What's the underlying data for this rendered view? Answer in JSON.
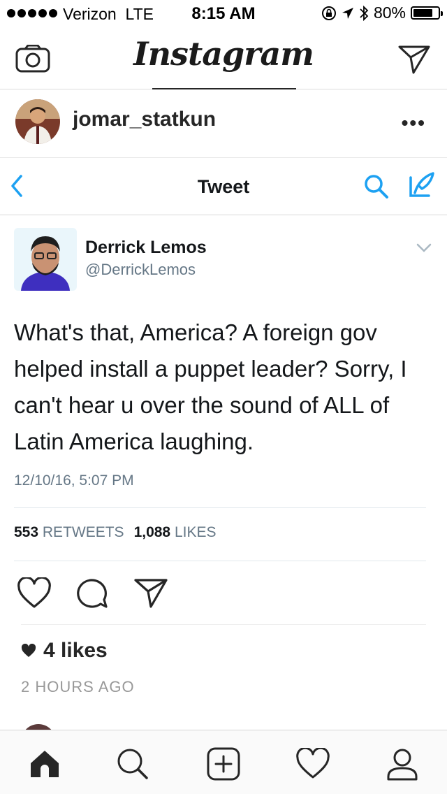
{
  "status_bar": {
    "carrier": "Verizon",
    "network": "LTE",
    "time": "8:15 AM",
    "battery": "80%",
    "battery_level": 0.8
  },
  "header": {
    "logo": "Instagram",
    "camera_icon": "camera-icon",
    "direct_icon": "paper-plane-icon"
  },
  "post": {
    "username": "jomar_statkun",
    "more": "•••",
    "likes_count": "4 likes",
    "time_ago": "2 HOURS AGO"
  },
  "tweet": {
    "nav_title": "Tweet",
    "author_name": "Derrick Lemos",
    "author_handle": "@DerrickLemos",
    "text": "What's that, America? A foreign gov helped install a puppet leader? Sorry, I can't hear u over the sound of ALL of Latin America laughing.",
    "date": "12/10/16, 5:07 PM",
    "retweets_count": "553",
    "retweets_label": "RETWEETS",
    "likes_count": "1,088",
    "likes_label": "LIKES",
    "accent_color": "#1da1f2"
  },
  "tab_bar": {
    "items": [
      "home-icon",
      "search-icon",
      "add-post-icon",
      "heart-icon",
      "profile-icon"
    ]
  }
}
